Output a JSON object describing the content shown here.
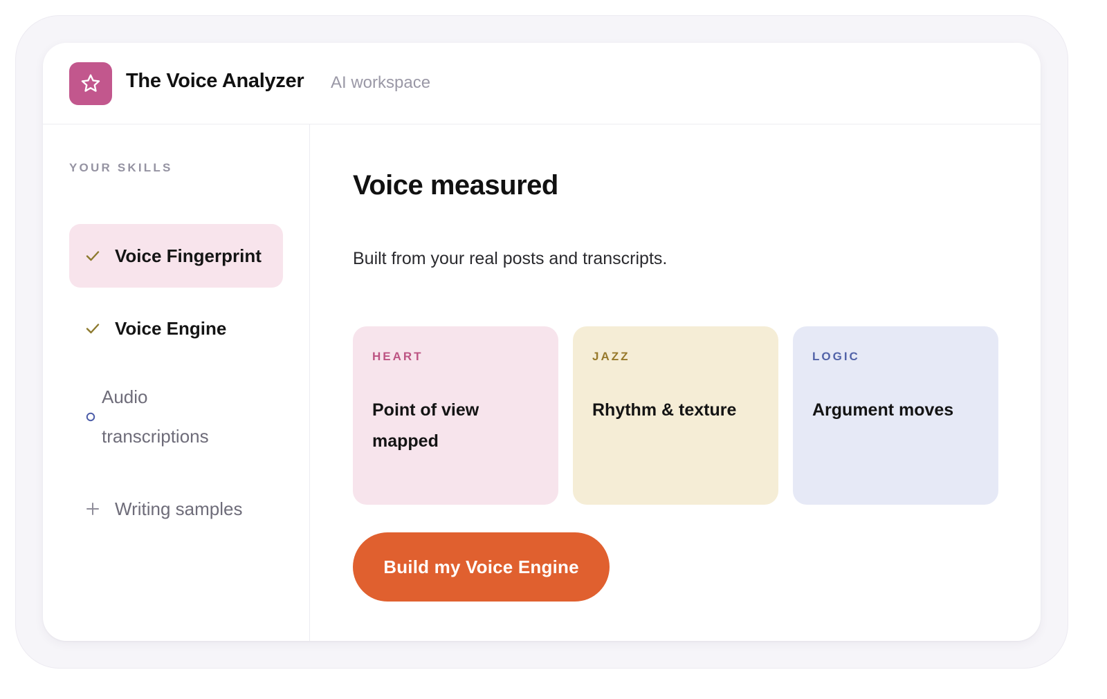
{
  "header": {
    "logo_icon": "star-icon",
    "title": "The Voice Analyzer",
    "subtitle": "AI workspace"
  },
  "sidebar": {
    "section_label": "YOUR SKILLS",
    "items": [
      {
        "label": "Voice Fingerprint",
        "status": "done",
        "icon": "check-icon",
        "active": true
      },
      {
        "label": "Voice Engine",
        "status": "done",
        "icon": "check-icon",
        "active": false
      },
      {
        "label": "Audio transcriptions",
        "status": "pending",
        "icon": "circle-icon",
        "active": false
      },
      {
        "label": "Writing samples",
        "status": "add",
        "icon": "plus-icon",
        "active": false
      }
    ]
  },
  "main": {
    "title": "Voice measured",
    "subtitle": "Built from your real posts and transcripts.",
    "cards": [
      {
        "tag": "HEART",
        "text": "Point of view mapped"
      },
      {
        "tag": "JAZZ",
        "text": "Rhythm & texture"
      },
      {
        "tag": "LOGIC",
        "text": "Argument moves"
      }
    ],
    "cta_label": "Build my Voice Engine"
  },
  "colors": {
    "logo_bg": "#c2578d",
    "check": "#8d7a2e",
    "pending_circle": "#4c5ca8",
    "plus": "#8e8c99",
    "heart_tag": "#bd5483",
    "jazz_tag": "#97792a",
    "logic_tag": "#5263a8",
    "cta_bg": "#e0602f"
  }
}
